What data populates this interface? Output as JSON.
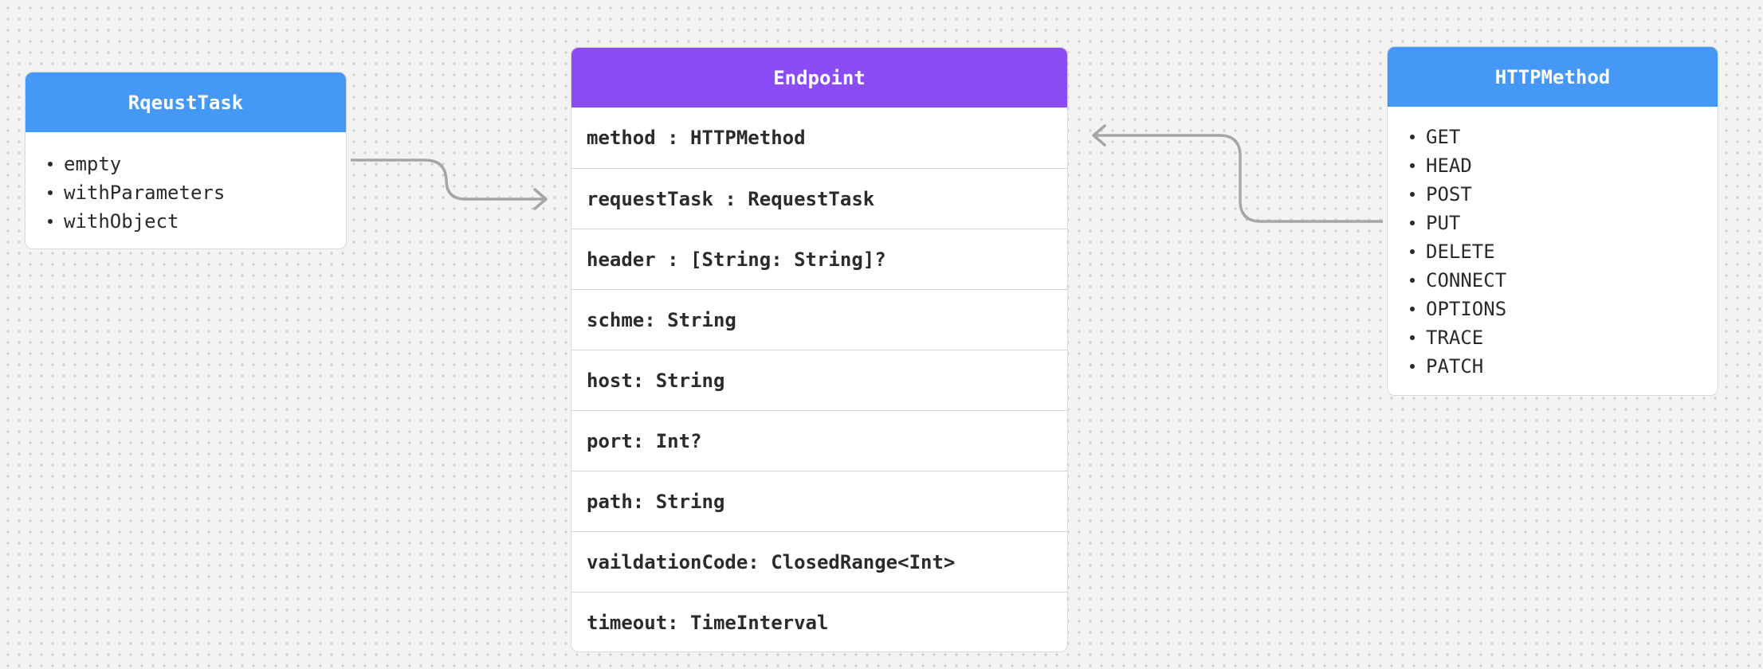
{
  "colors": {
    "blue_header": "#4698f7",
    "purple_header": "#8b4cf6",
    "connector": "#a6a6a6"
  },
  "request_task": {
    "title": "RqeustTask",
    "items": [
      "empty",
      "withParameters",
      "withObject"
    ]
  },
  "endpoint": {
    "title": "Endpoint",
    "fields": [
      "method : HTTPMethod",
      "requestTask : RequestTask",
      "header : [String: String]?",
      "schme: String",
      "host: String",
      "port: Int?",
      "path: String",
      "vaildationCode: ClosedRange<Int>",
      "timeout: TimeInterval"
    ]
  },
  "http_method": {
    "title": "HTTPMethod",
    "items": [
      "GET",
      "HEAD",
      "POST",
      "PUT",
      "DELETE",
      "CONNECT",
      "OPTIONS",
      "TRACE",
      "PATCH"
    ]
  }
}
